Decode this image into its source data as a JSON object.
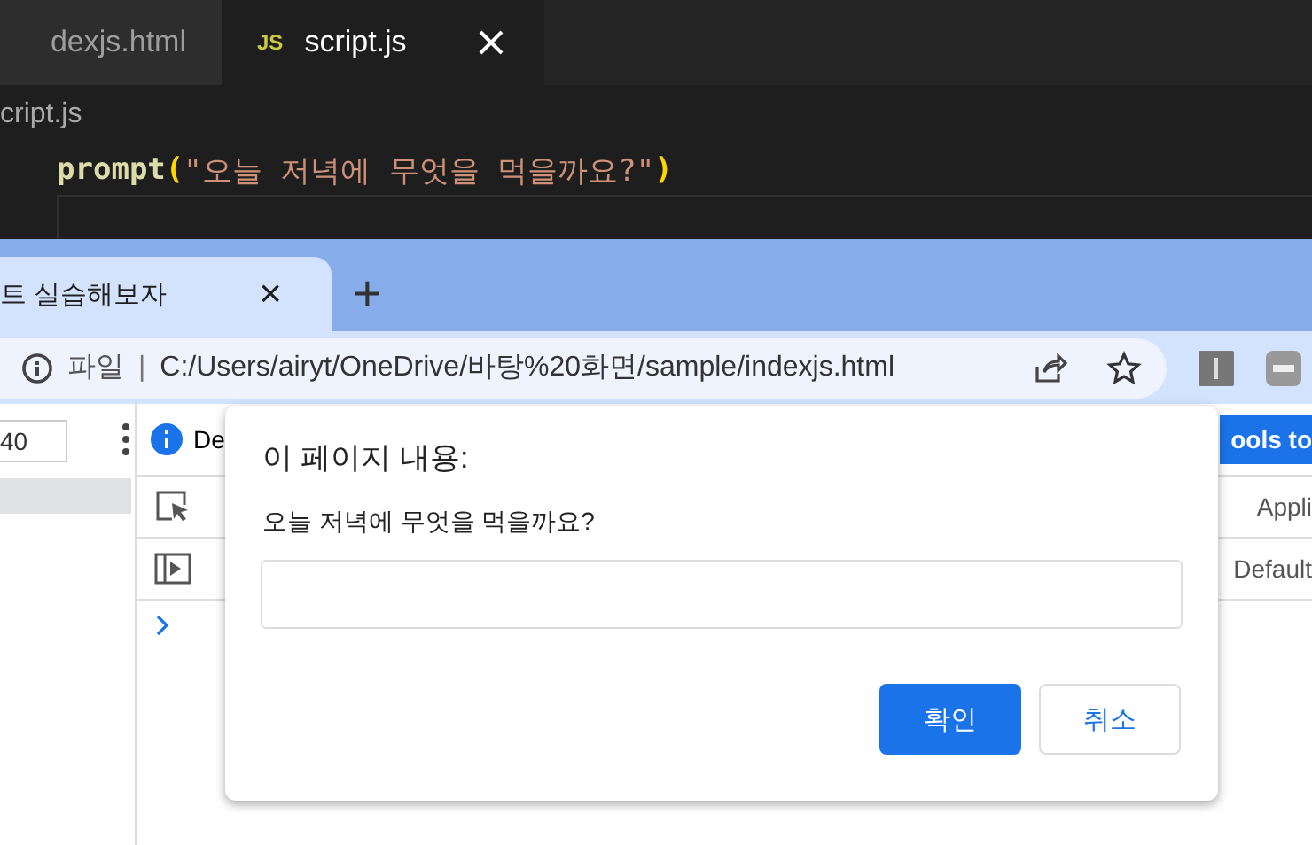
{
  "editor": {
    "tabs": [
      {
        "label": "dexjs.html",
        "selected": false
      },
      {
        "label": "script.js",
        "selected": true,
        "icon": "JS"
      }
    ],
    "breadcrumb": "cript.js",
    "code": {
      "func": "prompt",
      "open": "(",
      "string": "\"오늘 저녁에 무엇을 먹을까요?\"",
      "close": ")"
    }
  },
  "browser": {
    "tab": {
      "title": "트 실습해보자",
      "close": "×"
    },
    "new_tab": "+",
    "address": {
      "scheme": "파일",
      "separator": "|",
      "url": "C:/Users/airyt/OneDrive/바탕%20화면/sample/indexjs.html"
    }
  },
  "devtools": {
    "zoom_value": "40",
    "info_text": "De",
    "banner_button": "ools to",
    "tab_text": "Appli",
    "filter_text": "Default"
  },
  "dialog": {
    "title": "이 페이지 내용:",
    "message": "오늘 저녁에 무엇을 먹을까요?",
    "buttons": [
      {
        "label": "확인",
        "kind": "primary"
      },
      {
        "label": "취소",
        "kind": "secondary"
      }
    ]
  }
}
